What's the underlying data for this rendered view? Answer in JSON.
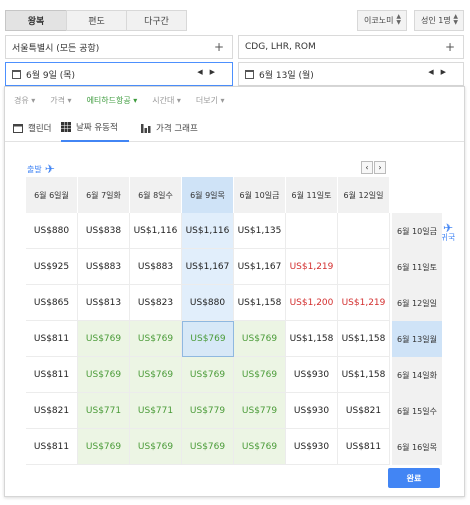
{
  "trip_types": [
    "왕복",
    "편도",
    "다구간"
  ],
  "cabin_class": "이코노미",
  "passengers": "성인 1명",
  "origin": "서울특별시 (모든 공항)",
  "destination": "CDG, LHR, ROM",
  "depart_date": "6월 9일 (목)",
  "return_date": "6월 13일 (월)",
  "filters": [
    {
      "label": "경유 ▾",
      "active": false
    },
    {
      "label": "가격 ▾",
      "active": false
    },
    {
      "label": "에티하드항공 ▾",
      "active": true
    },
    {
      "label": "시간대 ▾",
      "active": false
    },
    {
      "label": "더보기 ▾",
      "active": false
    }
  ],
  "view_tabs": [
    "캘린더",
    "날짜 유동적",
    "가격 그래프"
  ],
  "depart_label": "출발",
  "return_label": "귀국",
  "columns": [
    [
      "6월 6일",
      "월"
    ],
    [
      "6월 7일",
      "화"
    ],
    [
      "6월 8일",
      "수"
    ],
    [
      "6월 9일",
      "목"
    ],
    [
      "6월 10일",
      "금"
    ],
    [
      "6월 11일",
      "토"
    ],
    [
      "6월 12일",
      "일"
    ]
  ],
  "rows": [
    {
      "head": [
        "6월 10일",
        "금"
      ],
      "cells": [
        "US$880",
        "US$838",
        "US$1,116",
        "US$1,116",
        "US$1,135",
        "",
        ""
      ]
    },
    {
      "head": [
        "6월 11일",
        "토"
      ],
      "cells": [
        "US$925",
        "US$883",
        "US$883",
        "US$1,167",
        "US$1,167",
        "US$1,219",
        ""
      ]
    },
    {
      "head": [
        "6월 12일",
        "일"
      ],
      "cells": [
        "US$865",
        "US$813",
        "US$823",
        "US$880",
        "US$1,158",
        "US$1,200",
        "US$1,219"
      ]
    },
    {
      "head": [
        "6월 13일",
        "월"
      ],
      "cells": [
        "US$811",
        "US$769",
        "US$769",
        "US$769",
        "US$769",
        "US$1,158",
        "US$1,158"
      ]
    },
    {
      "head": [
        "6월 14일",
        "화"
      ],
      "cells": [
        "US$811",
        "US$769",
        "US$769",
        "US$769",
        "US$769",
        "US$930",
        "US$1,158"
      ]
    },
    {
      "head": [
        "6월 15일",
        "수"
      ],
      "cells": [
        "US$821",
        "US$771",
        "US$771",
        "US$779",
        "US$779",
        "US$930",
        "US$821"
      ]
    },
    {
      "head": [
        "6월 16일",
        "목"
      ],
      "cells": [
        "US$811",
        "US$769",
        "US$769",
        "US$769",
        "US$769",
        "US$930",
        "US$811"
      ]
    }
  ],
  "done_label": "완료",
  "colors": {
    "accent": "#4285f4",
    "cheap": "#4a9b38",
    "expensive": "#d32f2f"
  }
}
